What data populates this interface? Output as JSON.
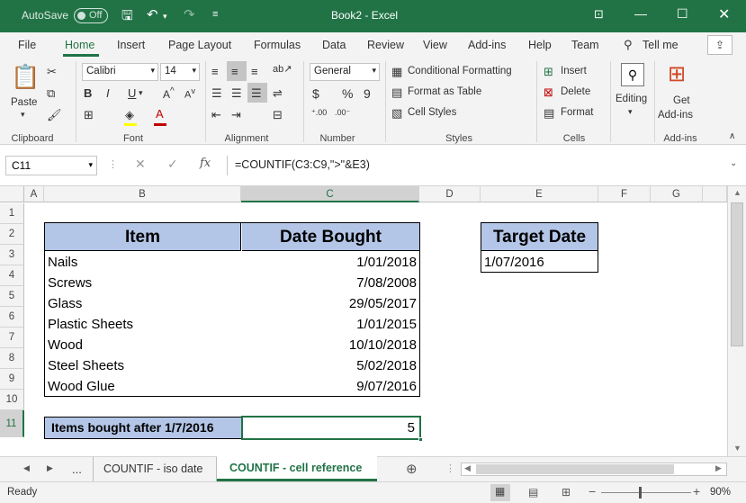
{
  "titlebar": {
    "autosave": "AutoSave",
    "autosave_state": "Off",
    "title": "Book2  -  Excel"
  },
  "tabs": [
    "File",
    "Home",
    "Insert",
    "Page Layout",
    "Formulas",
    "Data",
    "Review",
    "View",
    "Add-ins",
    "Help",
    "Team"
  ],
  "tell_me": "Tell me",
  "ribbon": {
    "clipboard": {
      "paste": "Paste",
      "label": "Clipboard"
    },
    "font": {
      "name": "Calibri",
      "size": "14",
      "label": "Font"
    },
    "alignment": {
      "label": "Alignment"
    },
    "number": {
      "format": "General",
      "label": "Number"
    },
    "styles": {
      "conditional": "Conditional Formatting",
      "table": "Format as Table",
      "cell_styles": "Cell Styles",
      "label": "Styles"
    },
    "cells": {
      "insert": "Insert",
      "delete": "Delete",
      "format": "Format",
      "label": "Cells"
    },
    "editing": {
      "label": "Editing"
    },
    "addins": {
      "get": "Get",
      "addins": "Add-ins",
      "label": "Add-ins"
    }
  },
  "formula_bar": {
    "name_box": "C11",
    "formula": "=COUNTIF(C3:C9,\">\"&E3)"
  },
  "columns": [
    "A",
    "B",
    "C",
    "D",
    "E",
    "F",
    "G"
  ],
  "rows": [
    "1",
    "2",
    "3",
    "4",
    "5",
    "6",
    "7",
    "8",
    "9",
    "10",
    "11"
  ],
  "table": {
    "header_item": "Item",
    "header_date": "Date Bought",
    "rows": [
      {
        "item": "Nails",
        "date": "1/01/2018"
      },
      {
        "item": "Screws",
        "date": "7/08/2008"
      },
      {
        "item": "Glass",
        "date": "29/05/2017"
      },
      {
        "item": "Plastic Sheets",
        "date": "1/01/2015"
      },
      {
        "item": "Wood",
        "date": "10/10/2018"
      },
      {
        "item": "Steel Sheets",
        "date": "5/02/2018"
      },
      {
        "item": "Wood Glue",
        "date": "9/07/2016"
      }
    ]
  },
  "target": {
    "header": "Target Date",
    "value": "1/07/2016"
  },
  "result": {
    "label": "Items bought after 1/7/2016",
    "value": "5"
  },
  "sheets": {
    "ellipsis": "...",
    "tab1": "COUNTIF - iso date",
    "tab2": "COUNTIF - cell reference"
  },
  "status": {
    "ready": "Ready",
    "zoom": "90%"
  },
  "colors": {
    "accent": "#217346",
    "header_fill": "#b4c6e7"
  }
}
